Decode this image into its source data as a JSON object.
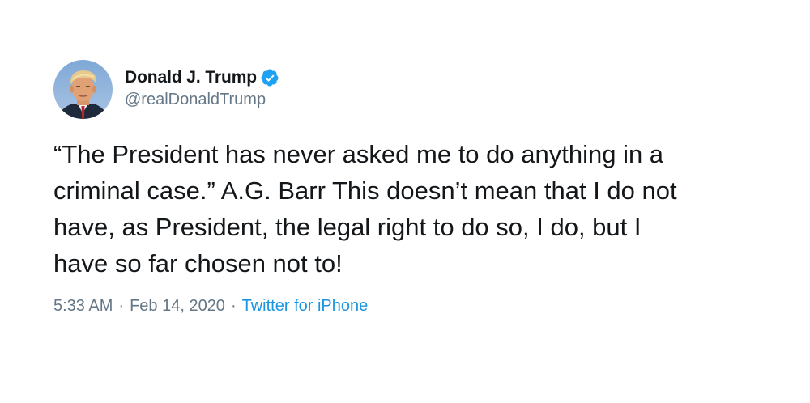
{
  "author": {
    "display_name": "Donald J. Trump",
    "handle": "@realDonaldTrump",
    "verified": true,
    "avatar_icon": "profile-photo"
  },
  "tweet": {
    "text": "“The President has never asked me to do anything in a\ncriminal case.” A.G. Barr  This doesn’t mean that I do not\nhave, as President, the legal right to do so, I do, but I\nhave so far chosen not to!"
  },
  "meta": {
    "time": "5:33 AM",
    "separator": "·",
    "date": "Feb 14, 2020",
    "source": "Twitter for iPhone"
  },
  "colors": {
    "text": "#14171a",
    "secondary": "#657786",
    "link": "#1b95e0",
    "verified_badge": "#1da1f2"
  }
}
